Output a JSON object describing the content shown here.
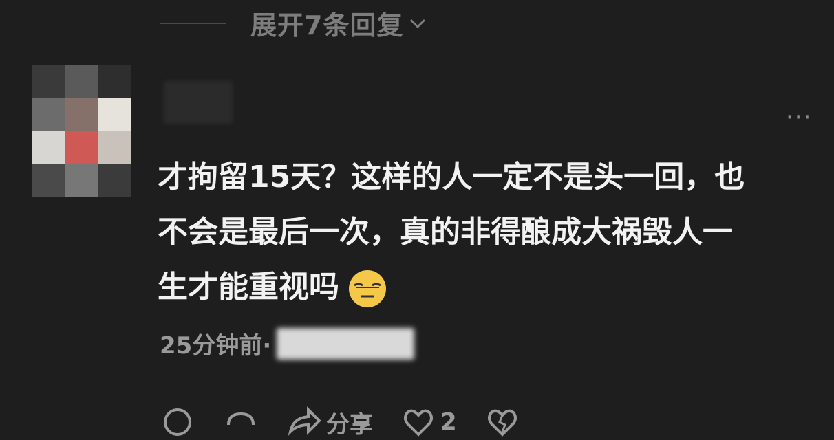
{
  "thread": {
    "expand_replies_label": "展开7条回复"
  },
  "comment": {
    "avatar_icon": "blurred-avatar",
    "more_icon": "ellipsis-icon",
    "lines": [
      "才拘留15天？这样的人一定不是头一回，也",
      "不会是最后一次，真的非得酿成大祸毁人一",
      "生才能重视吗"
    ],
    "emoji": "expressionless-face-emoji",
    "time": "25分钟前·"
  },
  "actions": {
    "share_label": "分享",
    "like_count": "2",
    "icons": [
      "comment-icon",
      "repost-icon",
      "share-icon",
      "like-icon",
      "dislike-icon"
    ]
  }
}
